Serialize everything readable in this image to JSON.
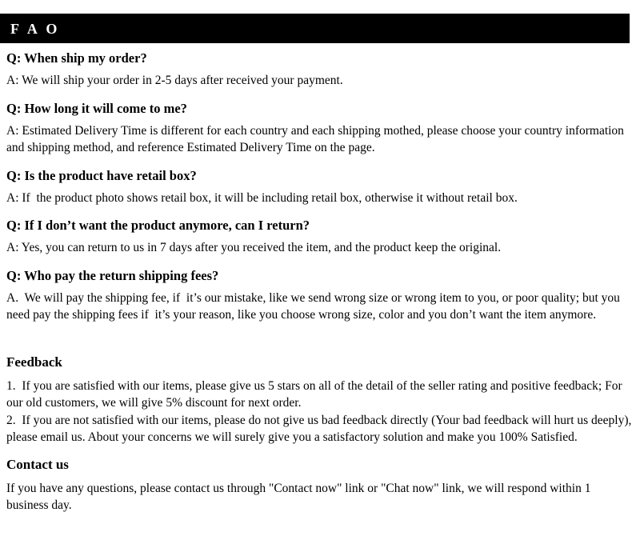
{
  "header": {
    "title": "F A O",
    "bar_color": "#000000",
    "text_color": "#ffffff"
  },
  "faq": {
    "items": [
      {
        "question": "Q: When ship my order?",
        "answer": "A: We will ship your order in 2-5 days after received your payment."
      },
      {
        "question": "Q: How long it will come to me?",
        "answer": "A: Estimated Delivery Time is different for each country and each shipping mothed, please choose your country information and shipping method, and reference Estimated Delivery Time on the page."
      },
      {
        "question": "Q: Is the product have retail box?",
        "answer": "A: If  the product photo shows retail box, it will be including retail box, otherwise it without retail box."
      },
      {
        "question": "Q: If I don’t want the product anymore, can I return?",
        "answer": "A: Yes, you can return to us in 7 days after you received the item, and the product keep the original."
      },
      {
        "question": "Q: Who pay the return shipping fees?",
        "answer": "A.  We will pay the shipping fee, if  it’s our mistake, like we send wrong size or wrong item to you, or poor quality; but you need pay the shipping fees if  it’s your reason, like you choose wrong size, color and you don’t want the item anymore."
      }
    ]
  },
  "feedback": {
    "heading": "Feedback",
    "item1": "1.  If you are satisfied with our items, please give us 5 stars on all of the detail of the seller rating and positive feedback; For our old customers, we will give 5% discount for next order.",
    "item2": "2.  If you are not satisfied with our items, please do not give us bad feedback directly (Your bad feedback will hurt us deeply), please email us. About your concerns we will surely give you a satisfactory solution and make you 100% Satisfied."
  },
  "contact": {
    "heading": "Contact us",
    "body": "If you have any questions, please contact us through \"Contact now\" link or \"Chat now\" link, we will respond within 1 business day."
  }
}
